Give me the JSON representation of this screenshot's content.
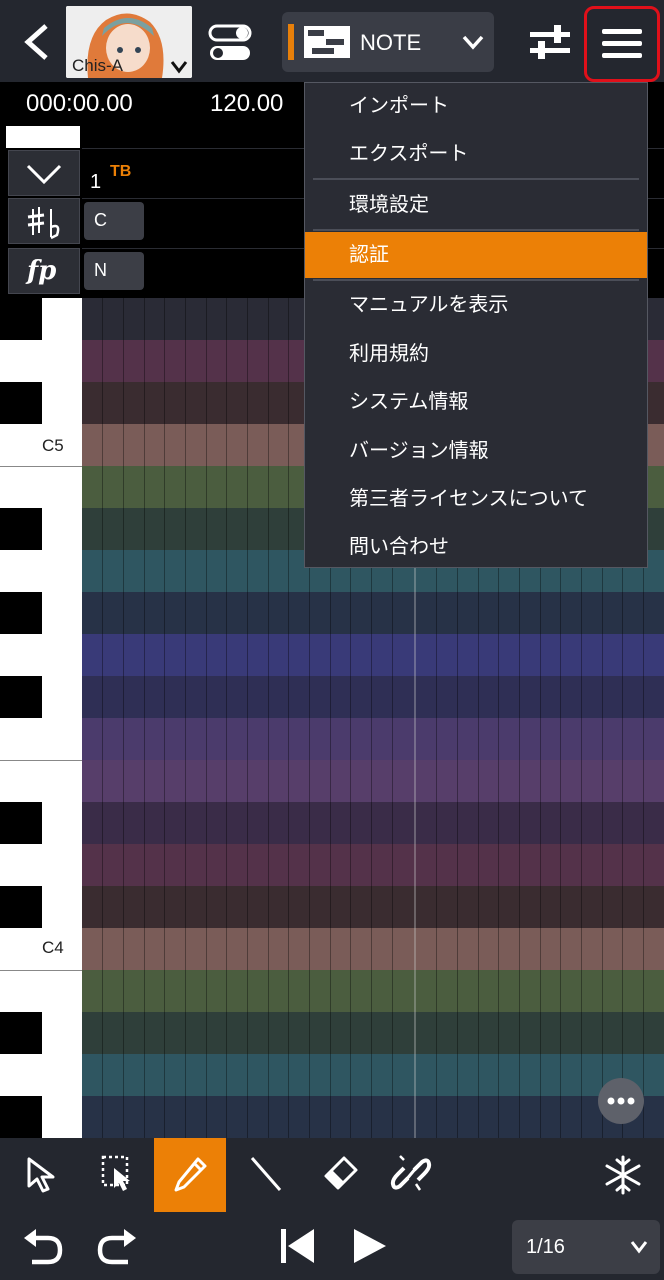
{
  "header": {
    "back_icon": "chevron-left-icon",
    "singer_name": "Chis-A",
    "mode_label": "NOTE",
    "colors": {
      "bar": "#24272f",
      "accent": "#ec8006",
      "highlight_border": "#e0101a"
    }
  },
  "timeline": {
    "time_readout": "000:00.00",
    "tempo": "120.00"
  },
  "track": {
    "measure_number": "1",
    "track_tag": "TB",
    "key_value": "C",
    "dynamics_value": "N"
  },
  "piano": {
    "labels": [
      "C5",
      "C4"
    ]
  },
  "menu": {
    "items": [
      {
        "label": "インポート"
      },
      {
        "label": "エクスポート"
      },
      {
        "label": "環境設定"
      },
      {
        "label": "認証"
      },
      {
        "label": "マニュアルを表示"
      },
      {
        "label": "利用規約"
      },
      {
        "label": "システム情報"
      },
      {
        "label": "バージョン情報"
      },
      {
        "label": "第三者ライセンスについて"
      },
      {
        "label": "問い合わせ"
      }
    ]
  },
  "toolbar": {
    "tools": [
      "select-arrow-icon",
      "range-select-icon",
      "pencil-icon",
      "line-icon",
      "eraser-icon",
      "link-icon",
      "snowflake-icon"
    ],
    "page_indicator": "1/16"
  }
}
